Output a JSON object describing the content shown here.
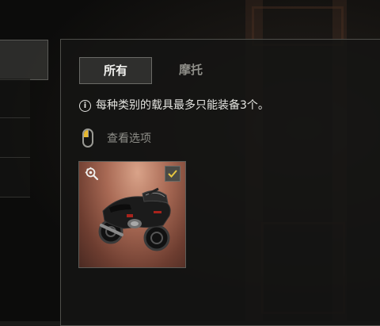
{
  "tabs": [
    {
      "label": "所有",
      "active": true
    },
    {
      "label": "摩托",
      "active": false
    }
  ],
  "info": {
    "icon": "info-icon",
    "text": "每种类别的载具最多只能装备3个。"
  },
  "view_options": {
    "icon": "mouse-icon",
    "label": "查看选项"
  },
  "vehicle_card": {
    "icons": [
      "zoom-gear-icon",
      "checkmark-icon"
    ],
    "equipped": true,
    "colors": {
      "check": "#e6c640",
      "accent": "#e6b830"
    }
  }
}
